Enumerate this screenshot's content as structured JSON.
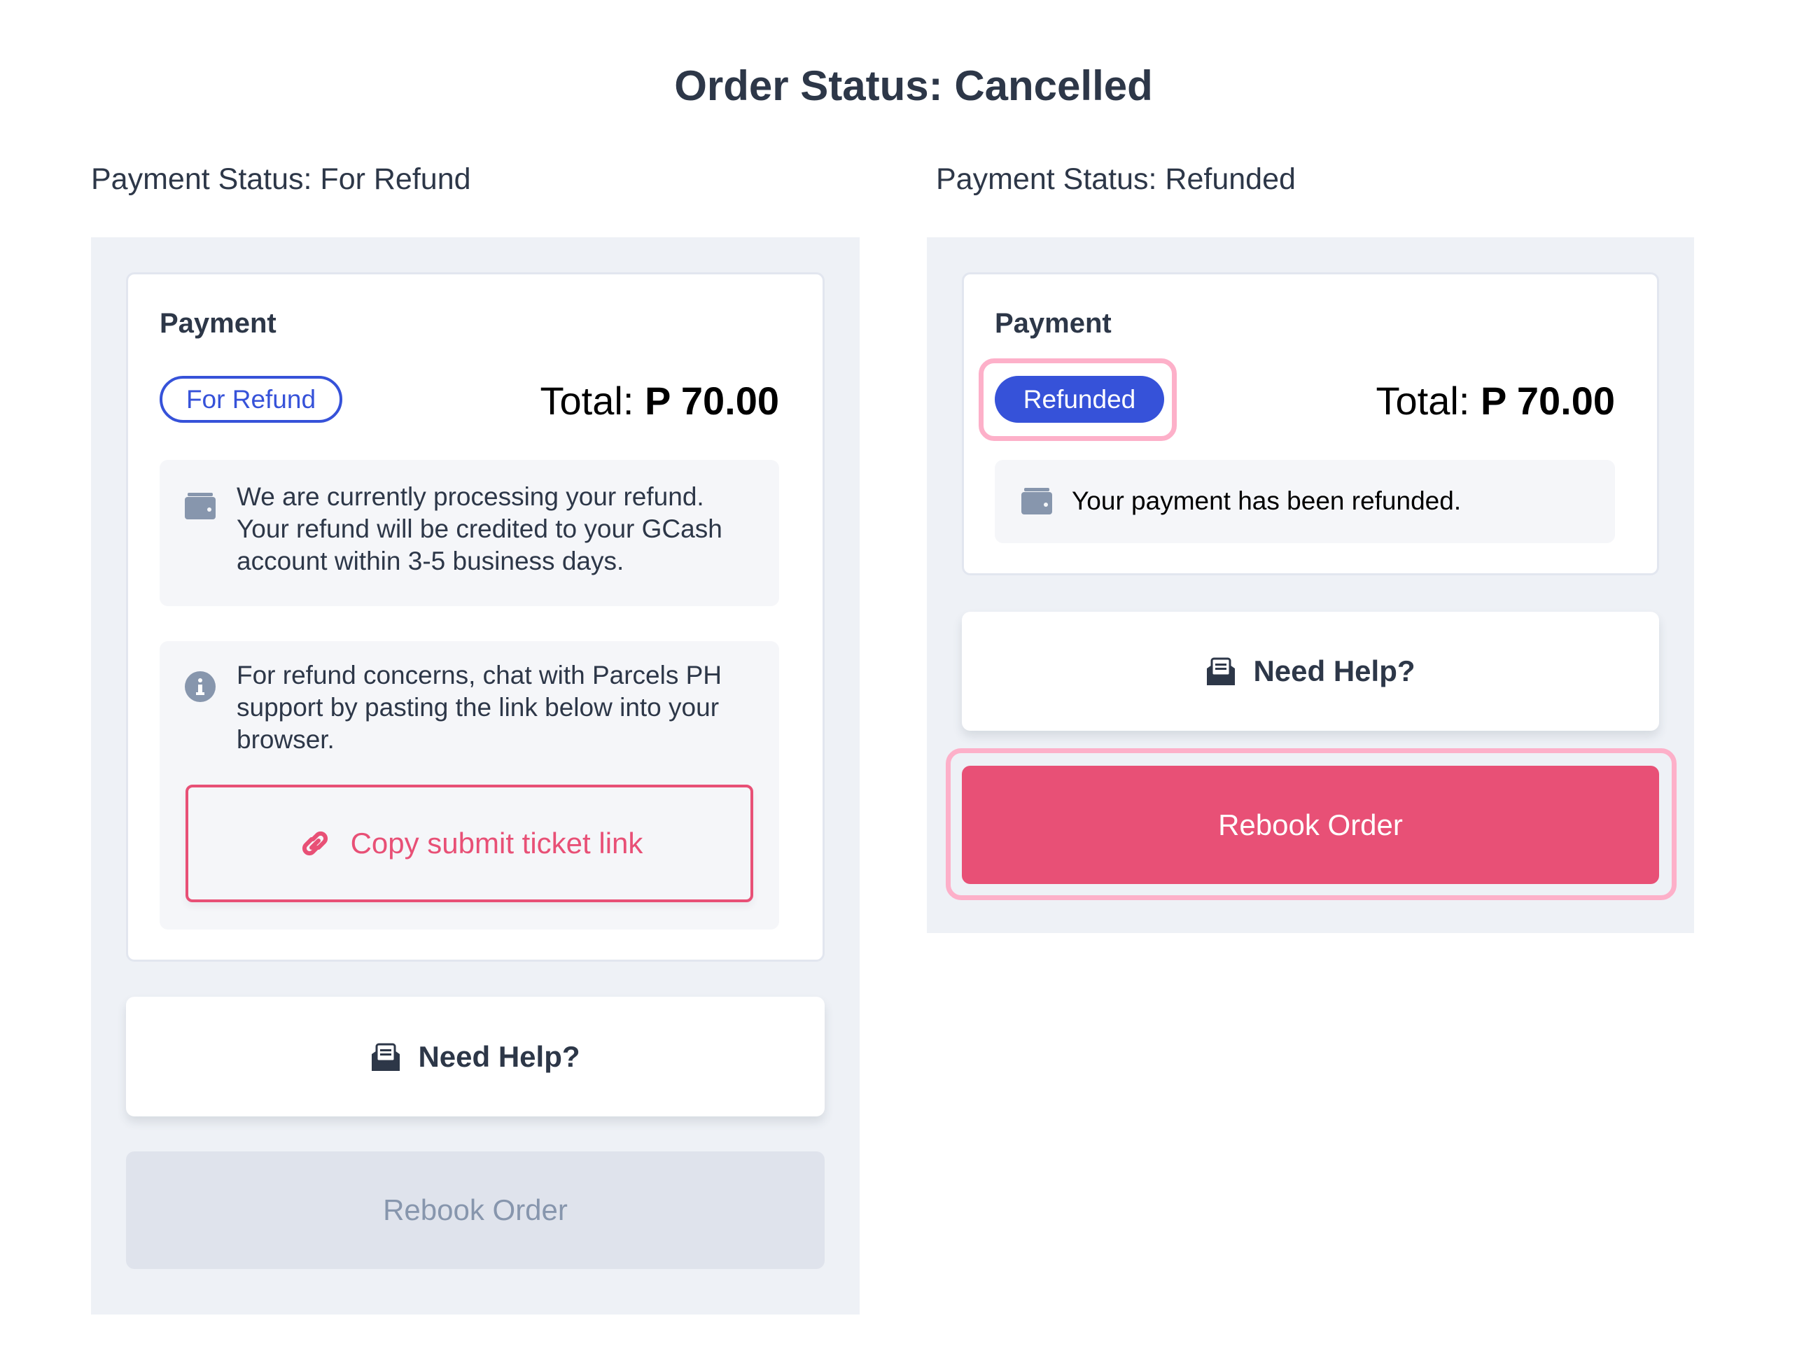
{
  "page": {
    "title": "Order Status: Cancelled"
  },
  "left": {
    "status_label": "Payment Status: For Refund",
    "card": {
      "heading": "Payment",
      "badge": "For Refund",
      "total_label": "Total:",
      "total_value": "P 70.00",
      "refund_info": [
        "We are currently processing your refund.",
        "Your refund will be credited to your GCash",
        "account within 3-5 business days."
      ],
      "concern_info": [
        "For refund concerns, chat with Parcels PH",
        "support by pasting the link below into your",
        "browser."
      ],
      "copy_link_label": "Copy submit ticket link"
    },
    "need_help_label": "Need Help?",
    "rebook_label": "Rebook Order",
    "rebook_state": "disabled"
  },
  "right": {
    "status_label": "Payment Status: Refunded",
    "card": {
      "heading": "Payment",
      "badge": "Refunded",
      "total_label": "Total:",
      "total_value": "P 70.00",
      "refund_info": "Your payment has been refunded."
    },
    "need_help_label": "Need Help?",
    "rebook_label": "Rebook Order",
    "rebook_state": "enabled"
  },
  "colors": {
    "text": "#2d3748",
    "badge_blue": "#3652d9",
    "accent_pink": "#e85076",
    "highlight_pink": "#fdb0c9",
    "panel_bg": "#eef1f6",
    "disabled_bg": "#dfe3ec",
    "disabled_text": "#8796ad",
    "icon_gray": "#8796ad"
  },
  "icons": {
    "wallet": "wallet-icon",
    "info": "info-icon",
    "link": "link-icon",
    "help": "envelope-open-icon"
  }
}
